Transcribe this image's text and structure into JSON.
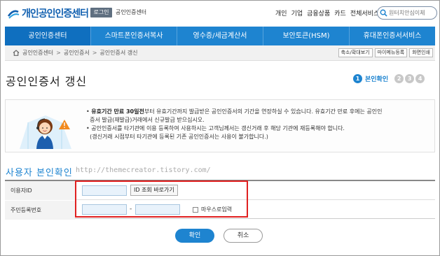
{
  "header": {
    "logo_text": "개인공인인증센터",
    "login_label": "로그인",
    "site_name": "공인인증센터",
    "util_links": [
      "개인",
      "기업",
      "금융상품",
      "카드"
    ],
    "all_services": "전체서비스",
    "search_placeholder": "원터치안심이체"
  },
  "nav": {
    "items": [
      {
        "label": "공인인증센터",
        "active": true
      },
      {
        "label": "스마트폰인증서복사",
        "active": false
      },
      {
        "label": "영수증/세금계산서",
        "active": false
      },
      {
        "label": "보안토큰(HSM)",
        "active": false
      },
      {
        "label": "휴대폰인증서서비스",
        "active": false
      }
    ]
  },
  "breadcrumb": {
    "items": [
      "공인인증센터",
      "공인인증서",
      "공인인증서 갱신"
    ],
    "buttons": [
      "축소/확대보기",
      "마이메뉴등록",
      "화면인쇄"
    ]
  },
  "page": {
    "title": "공인인증서 갱신",
    "steps": [
      "1",
      "2",
      "3",
      "4"
    ],
    "active_step_label": "본인확인"
  },
  "notice": {
    "line1_bold": "유효기간 만료 30일전",
    "line1_rest": "부터 유효기간까지 발급받은 공인인증서의 기간을 연장하실 수 있습니다. 유효기간 만료 후에는 공인인",
    "line2": "증서 발급(재발급)거래에서 신규발급 받으십시오.",
    "line3": "공인인증서를 타기관에 이용 등록하여 사용하시는 고객님께서는 갱신거래 후 해당 기관에 재등록해야 합니다.",
    "line4": "(갱신거래 시점부터 타기관에 등록된 기존 공인인증서는 사용이 불가합니다.)"
  },
  "section": {
    "title": "사용자 본인확인",
    "watermark": "http://themecreator.tistory.com/"
  },
  "form": {
    "user_id_label": "이용자ID",
    "id_lookup_button": "ID 조회 바로가기",
    "resident_label": "주민등록번호",
    "dash": "-",
    "mouse_input_label": "마우스로입력"
  },
  "actions": {
    "confirm": "확인",
    "cancel": "취소"
  },
  "colors": {
    "brand_blue": "#1e84d0",
    "highlight_red": "#e02020"
  }
}
